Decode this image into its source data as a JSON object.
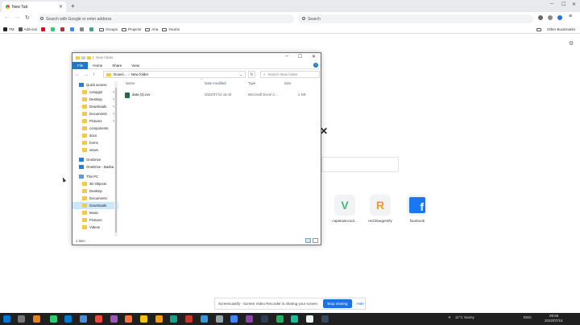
{
  "browser": {
    "tab_title": "New Tab",
    "address_placeholder": "Search with Google or enter address",
    "search_placeholder": "Search"
  },
  "bookmarks": [
    {
      "label": "TM",
      "color": "#222"
    },
    {
      "label": "Add-ons",
      "color": "#555"
    },
    {
      "label": "",
      "color": "#e50914"
    },
    {
      "label": "",
      "color": "#25d366"
    },
    {
      "label": "",
      "color": "#a33"
    },
    {
      "label": "",
      "color": "#2d8cff"
    },
    {
      "label": "",
      "color": "#888"
    },
    {
      "label": "",
      "color": "#3a8"
    },
    {
      "label": "Groups",
      "folder": true
    },
    {
      "label": "Projects",
      "folder": true
    },
    {
      "label": "Ana",
      "folder": true
    },
    {
      "label": "Youms",
      "folder": true
    }
  ],
  "other_bookmarks": "Other Bookmarks",
  "shortcuts": [
    {
      "label": "capetowncool...",
      "color": "#41b883",
      "glyph": "V"
    },
    {
      "label": "red.bluegemify",
      "color": "#f39c12",
      "glyph": "R"
    },
    {
      "label": "facebook",
      "color": "#1877f2",
      "glyph": "f"
    }
  ],
  "explorer": {
    "title": "New folder",
    "ribbon_tabs": [
      "File",
      "Home",
      "Share",
      "View"
    ],
    "path": [
      "Downl...",
      "New folder"
    ],
    "search_placeholder": "Search New folder",
    "nav_items": [
      {
        "label": "Quick access",
        "level": 0,
        "icon": "star-icon"
      },
      {
        "label": "compgi2",
        "level": 1,
        "pin": true
      },
      {
        "label": "Desktop",
        "level": 1,
        "pin": true
      },
      {
        "label": "Downloads",
        "level": 1,
        "pin": true
      },
      {
        "label": "Documents",
        "level": 1,
        "pin": true
      },
      {
        "label": "Pictures",
        "level": 1,
        "pin": true
      },
      {
        "label": "components",
        "level": 1
      },
      {
        "label": "docs",
        "level": 1
      },
      {
        "label": "forms",
        "level": 1
      },
      {
        "label": "views",
        "level": 1
      },
      {
        "label": "OneDrive",
        "level": 0
      },
      {
        "label": "OneDrive - Basba",
        "level": 0
      },
      {
        "label": "This PC",
        "level": 0
      },
      {
        "label": "3D Objects",
        "level": 1
      },
      {
        "label": "Desktop",
        "level": 1
      },
      {
        "label": "Documents",
        "level": 1
      },
      {
        "label": "Downloads",
        "level": 1,
        "selected": true
      },
      {
        "label": "Music",
        "level": 1
      },
      {
        "label": "Pictures",
        "level": 1
      },
      {
        "label": "Videos",
        "level": 1
      }
    ],
    "columns": [
      "Name",
      "Date modified",
      "Type",
      "Size"
    ],
    "files": [
      {
        "name": "data (3).csv",
        "date": "2022/07/14 16:42",
        "type": "Microsoft Excel C...",
        "size": "2 KB"
      }
    ],
    "status": "1 item"
  },
  "share_bar": {
    "message": "Screencastify - Screen Video Recorder is sharing your screen.",
    "stop": "Stop sharing",
    "hide": "Hide"
  },
  "taskbar": {
    "weather": "11°C  Sunny",
    "lang": "ENG",
    "time": "09:55",
    "date": "2022/07/15"
  }
}
